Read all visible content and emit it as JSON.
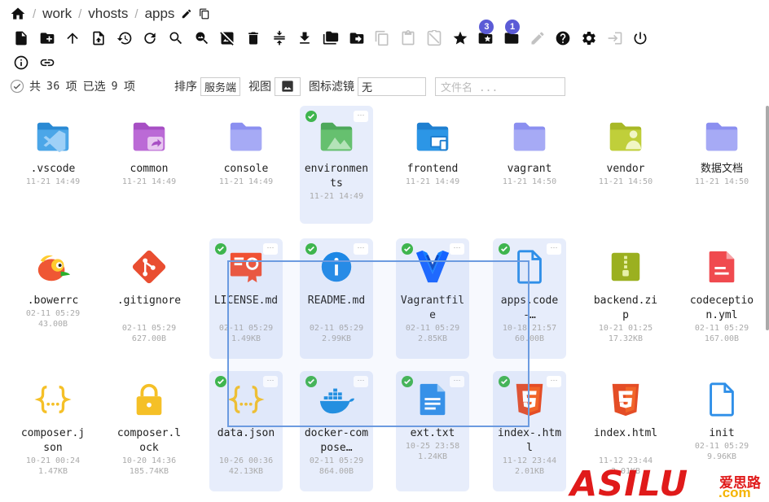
{
  "breadcrumb": [
    "work",
    "vhosts",
    "apps"
  ],
  "toolbar": {
    "badges": {
      "collect": "3",
      "folder": "1"
    }
  },
  "status": {
    "total_prefix": "共",
    "total_count": "36",
    "total_unit": "项",
    "selected_prefix": "已选",
    "selected_count": "9",
    "selected_unit": "项",
    "sort_label": "排序",
    "sort_value": "服务端",
    "view_label": "视图",
    "filter_label": "图标滤镜",
    "filter_value": "无",
    "search_placeholder": "文件名 ..."
  },
  "files": [
    {
      "name": ".vscode",
      "date": "11-21 14:49",
      "size": "",
      "icon": "folder-vscode-icon",
      "selected": false
    },
    {
      "name": "common",
      "date": "11-21 14:49",
      "size": "",
      "icon": "folder-shared-icon",
      "selected": false
    },
    {
      "name": "console",
      "date": "11-21 14:49",
      "size": "",
      "icon": "folder-icon",
      "selected": false
    },
    {
      "name": "environments",
      "date": "11-21 14:49",
      "size": "",
      "icon": "folder-environment-icon",
      "selected": true
    },
    {
      "name": "frontend",
      "date": "11-21 14:49",
      "size": "",
      "icon": "folder-frontend-icon",
      "selected": false
    },
    {
      "name": "vagrant",
      "date": "11-21 14:50",
      "size": "",
      "icon": "folder-icon",
      "selected": false
    },
    {
      "name": "vendor",
      "date": "11-21 14:50",
      "size": "",
      "icon": "folder-vendor-icon",
      "selected": false
    },
    {
      "name": "数据文档",
      "date": "11-21 14:50",
      "size": "",
      "icon": "folder-icon",
      "selected": false
    },
    {
      "name": ".bowerrc",
      "date": "02-11 05:29",
      "size": "43.00B",
      "icon": "bower-icon",
      "selected": false
    },
    {
      "name": ".gitignore",
      "date": "02-11 05:29",
      "size": "627.00B",
      "icon": "git-icon",
      "selected": false
    },
    {
      "name": "LICENSE.md",
      "date": "02-11 05:29",
      "size": "1.49KB",
      "icon": "license-icon",
      "selected": true
    },
    {
      "name": "README.md",
      "date": "02-11 05:29",
      "size": "2.99KB",
      "icon": "info-icon",
      "selected": true
    },
    {
      "name": "Vagrantfile",
      "date": "02-11 05:29",
      "size": "2.85KB",
      "icon": "vagrant-icon",
      "selected": true
    },
    {
      "name": "apps.code-…",
      "date": "10-18 21:57",
      "size": "60.00B",
      "icon": "file-icon",
      "selected": true
    },
    {
      "name": "backend.zip",
      "date": "10-21 01:25",
      "size": "17.32KB",
      "icon": "zip-icon",
      "selected": false
    },
    {
      "name": "codeception.yml",
      "date": "02-11 05:29",
      "size": "167.00B",
      "icon": "yaml-icon",
      "selected": false
    },
    {
      "name": "composer.json",
      "date": "10-21 00:24",
      "size": "1.47KB",
      "icon": "json-icon",
      "selected": false
    },
    {
      "name": "composer.lock",
      "date": "10-20 14:36",
      "size": "185.74KB",
      "icon": "lock-icon",
      "selected": false
    },
    {
      "name": "data.json",
      "date": "10-26 00:36",
      "size": "42.13KB",
      "icon": "json-icon",
      "selected": true
    },
    {
      "name": "docker-compose…",
      "date": "02-11 05:29",
      "size": "864.00B",
      "icon": "docker-icon",
      "selected": true
    },
    {
      "name": "ext.txt",
      "date": "10-25 23:58",
      "size": "1.24KB",
      "icon": "text-file-icon",
      "selected": true
    },
    {
      "name": "index-.html",
      "date": "11-12 23:44",
      "size": "2.01KB",
      "icon": "html5-icon",
      "selected": true
    },
    {
      "name": "index.html",
      "date": "11-12 23:44",
      "size": "2.01KB",
      "icon": "html5-icon",
      "selected": false
    },
    {
      "name": "init",
      "date": "02-11 05:29",
      "size": "9.96KB",
      "icon": "file-icon",
      "selected": false
    }
  ],
  "watermark": {
    "brand": "ASILU",
    "cn": "爱思路",
    "domain": ".com"
  }
}
